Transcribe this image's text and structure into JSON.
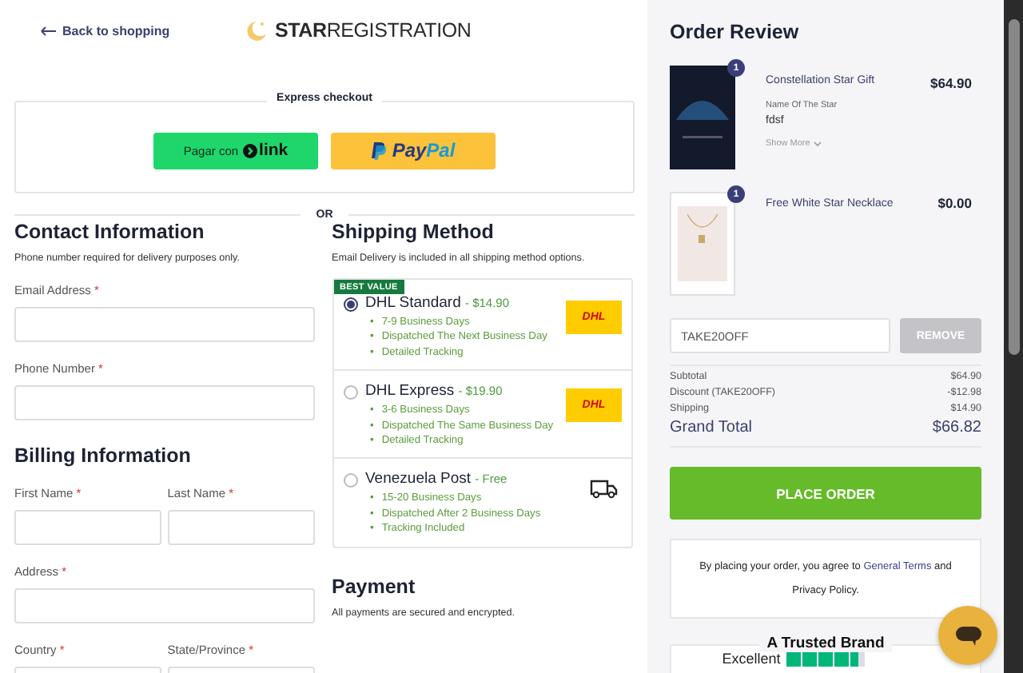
{
  "header": {
    "back_link": "Back to shopping",
    "logo_bold": "STAR",
    "logo_light": "REGISTRATION"
  },
  "express_checkout": {
    "title": "Express checkout",
    "buttons": [
      {
        "kind": "link",
        "label": "Pagar con",
        "brand": "link"
      },
      {
        "kind": "paypal",
        "brand": "Pay",
        "brand_2": "Pal"
      }
    ]
  },
  "divider_label": "OR",
  "contact": {
    "title": "Contact Information",
    "note": "Phone number required for delivery purposes only.",
    "rows": [
      [
        {
          "label": "Email Address",
          "mark": "*"
        }
      ],
      [
        {
          "label": "Phone Number",
          "mark": "*"
        }
      ]
    ]
  },
  "billing": {
    "title": "Billing Information",
    "rows": [
      [
        {
          "label": "First Name",
          "mark": "*"
        },
        {
          "label": "Last Name",
          "mark": "*"
        }
      ],
      [
        {
          "label": "Address",
          "mark": "*"
        }
      ],
      [
        {
          "label": "Country",
          "mark": "*"
        },
        {
          "label": "State/Province",
          "mark": "*"
        }
      ]
    ]
  },
  "shipping": {
    "title": "Shipping Method",
    "note": "Email Delivery is included in all shipping method options.",
    "badge": "BEST VALUE",
    "bullet": "•",
    "options": [
      {
        "name": "DHL Standard",
        "price": "- $14.90",
        "selected": true,
        "kind": "dhl",
        "logo": "DHL",
        "features": [
          "7-9 Business Days",
          "Dispatched The Next Business Day",
          "Detailed Tracking"
        ]
      },
      {
        "name": "DHL Express",
        "price": "- $19.90",
        "selected": false,
        "kind": "dhl",
        "logo": "DHL",
        "features": [
          "3-6 Business Days",
          "Dispatched The Same Business Day",
          "Detailed Tracking"
        ]
      },
      {
        "name": "Venezuela Post",
        "price": "- Free",
        "selected": false,
        "kind": "truck",
        "features": [
          "15-20 Business Days",
          "Dispatched After 2 Business Days",
          "Tracking Included"
        ]
      }
    ]
  },
  "payment": {
    "title": "Payment",
    "note": "All payments are secured and encrypted."
  },
  "order_review": {
    "title": "Order Review",
    "items": [
      {
        "quantity": "1",
        "name": "Constellation Star Gift",
        "price": "$64.90",
        "kind": "poster",
        "detail_label": "Name Of The Star",
        "detail_value": "fdsf",
        "show_more": "Show More"
      },
      {
        "quantity": "1",
        "name": "Free White Star Necklace",
        "price": "$0.00",
        "kind": "necklace"
      }
    ],
    "coupon": {
      "value": "TAKE20OFF",
      "button": "REMOVE",
      "disabled": true
    },
    "totals": [
      {
        "label": "Subtotal",
        "value": "$64.90"
      },
      {
        "label": "Discount (TAKE20OFF)",
        "value": "-$12.98"
      },
      {
        "label": "Shipping",
        "value": "$14.90"
      }
    ],
    "grand_total": {
      "label": "Grand Total",
      "value": "$66.82"
    },
    "place_order": "PLACE ORDER",
    "terms": {
      "before": "By placing your order, you agree to",
      "link": "General Terms",
      "after": "and Privacy Policy."
    },
    "trust": {
      "title": "A Trusted Brand",
      "rating": "Excellent",
      "stars": 4.5
    }
  }
}
